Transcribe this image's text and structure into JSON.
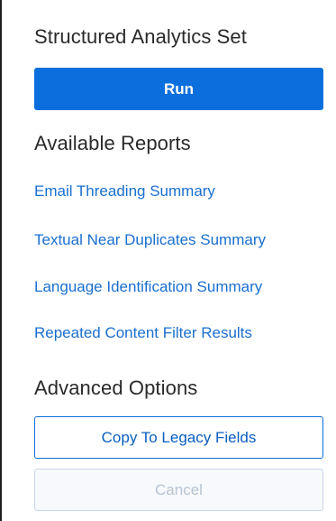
{
  "panel": {
    "set_title": "Structured Analytics Set",
    "run_label": "Run",
    "reports_title": "Available Reports",
    "reports": [
      {
        "label": "Email Threading Summary"
      },
      {
        "label": "Textual Near Duplicates Summary"
      },
      {
        "label": "Language Identification Summary"
      },
      {
        "label": "Repeated Content Filter Results"
      }
    ],
    "advanced_title": "Advanced Options",
    "copy_label": "Copy To Legacy Fields",
    "cancel_label": "Cancel",
    "cancel_disabled": true
  },
  "colors": {
    "primary": "#0a6fdc",
    "link": "#1a6fd0",
    "disabled_text": "#b8c4d4"
  }
}
